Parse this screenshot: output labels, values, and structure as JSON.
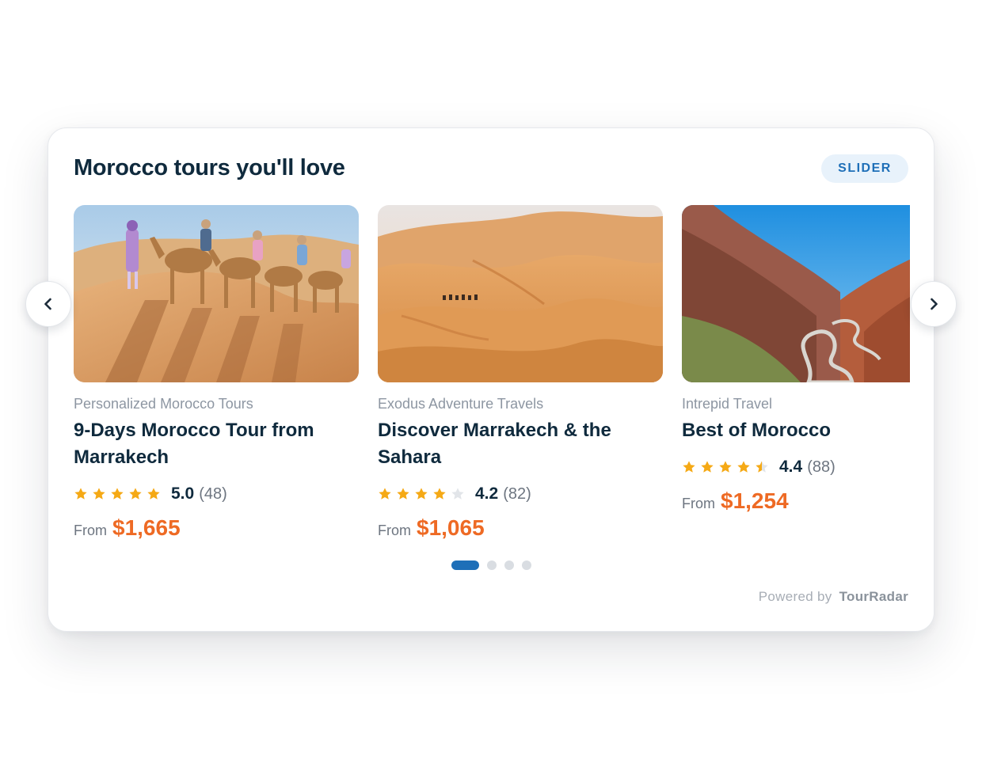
{
  "widget": {
    "title": "Morocco tours you'll love",
    "badge": "SLIDER",
    "prev_icon": "chevron-left-icon",
    "next_icon": "chevron-right-icon",
    "footer": {
      "prefix": "Powered by",
      "brand": "TourRadar"
    },
    "pagination": {
      "pages": 4,
      "active": 1
    }
  },
  "tours": [
    {
      "operator": "Personalized Morocco Tours",
      "name": "9-Days Morocco Tour from Marrakech",
      "rating": 5.0,
      "rating_text": "5.0",
      "reviews": "(48)",
      "from_label": "From",
      "price": "$1,665",
      "image_icon": "camel-caravan-desert-photo"
    },
    {
      "operator": "Exodus Adventure Travels",
      "name": "Discover Marrakech & the Sahara",
      "rating": 4.2,
      "rating_text": "4.2",
      "reviews": "(82)",
      "from_label": "From",
      "price": "$1,065",
      "image_icon": "sahara-dunes-photo"
    },
    {
      "operator": "Intrepid Travel",
      "name": "Best of Morocco",
      "rating": 4.4,
      "rating_text": "4.4",
      "reviews": "(88)",
      "from_label": "From",
      "price": "$1,254",
      "image_icon": "atlas-gorge-road-photo"
    }
  ],
  "colors": {
    "title": "#0f2a3d",
    "accent_blue": "#1e6fb8",
    "price_orange": "#ee6a24",
    "star_gold": "#f5a915",
    "star_empty": "#e2e5e9"
  }
}
